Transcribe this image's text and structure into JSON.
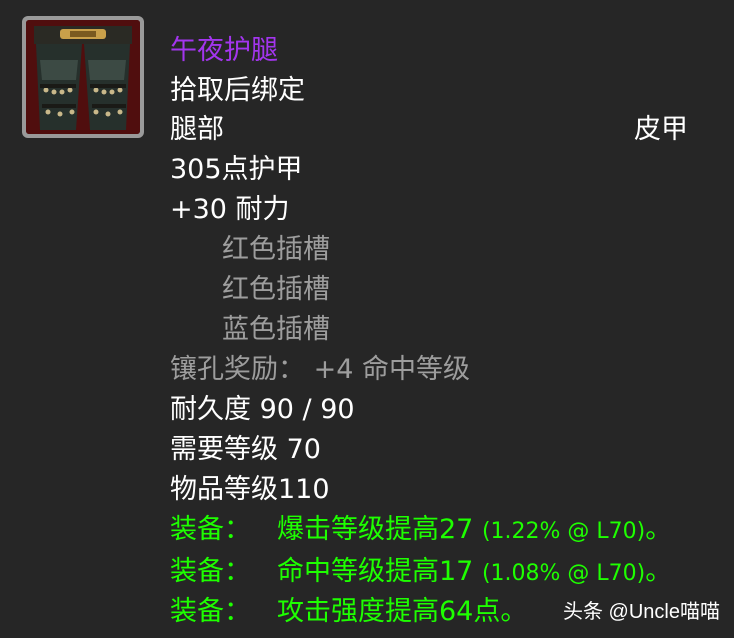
{
  "item": {
    "name": "午夜护腿",
    "name_color": "#a335ee",
    "binding": "拾取后绑定",
    "slot": "腿部",
    "armor_type": "皮甲",
    "armor": "305点护甲",
    "stamina": "+30 耐力",
    "sockets": [
      "红色插槽",
      "红色插槽",
      "蓝色插槽"
    ],
    "socket_bonus": "镶孔奖励： +4 命中等级",
    "durability": "耐久度 90 / 90",
    "required_level": "需要等级 70",
    "item_level": "物品等级110",
    "equip_effects": [
      {
        "prefix": "装备：",
        "text": "爆击等级提高27",
        "detail": "(1.22% @ L70)",
        "end": "。"
      },
      {
        "prefix": "装备：",
        "text": "命中等级提高17",
        "detail": "(1.08% @ L70)",
        "end": "。"
      },
      {
        "prefix": "装备：",
        "text": "攻击强度提高64点",
        "detail": "",
        "end": "。"
      }
    ],
    "icon": "leather-leggings-icon"
  },
  "watermark": "头条 @Uncle喵喵",
  "colors": {
    "background": "#262626",
    "epic": "#a335ee",
    "green": "#1eff00",
    "gray": "#9d9d9d"
  }
}
